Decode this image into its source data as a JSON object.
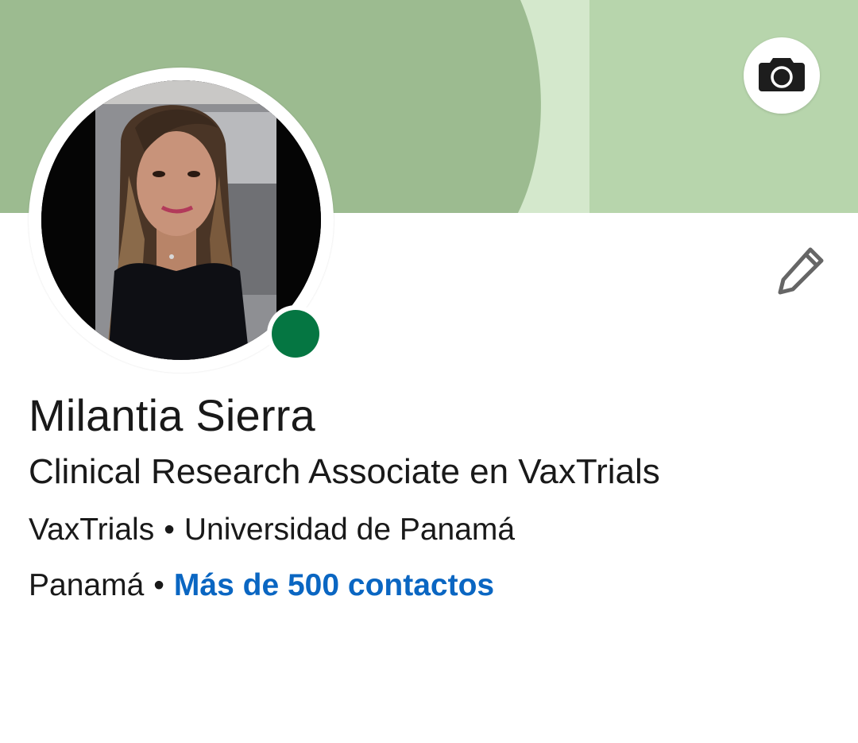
{
  "colors": {
    "cover_left": "#9cbb90",
    "cover_mid": "#d4e8cc",
    "cover_right": "#b7d5ac",
    "online_status": "#057642",
    "link": "#0a66c2",
    "text": "#191919"
  },
  "cover": {
    "camera_icon": "camera-icon"
  },
  "profile": {
    "name": "Milantia Sierra",
    "headline": "Clinical Research Associate en VaxTrials",
    "company": "VaxTrials",
    "education": "Universidad de Panamá",
    "location": "Panamá",
    "separator": "•",
    "contacts_link": "Más de 500 contactos",
    "edit_icon": "pencil-icon",
    "status": "online"
  }
}
